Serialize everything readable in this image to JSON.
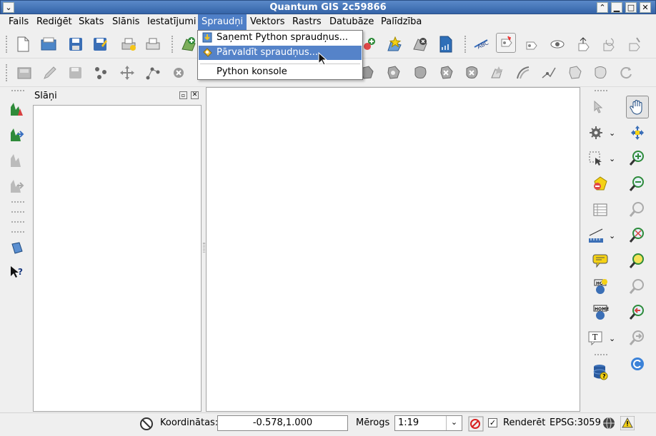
{
  "window": {
    "title": "Quantum GIS 2c59866"
  },
  "menubar": {
    "items": [
      "Fails",
      "Rediģēt",
      "Skats",
      "Slānis",
      "Iestatījumi",
      "Spraudņi",
      "Vektors",
      "Rastrs",
      "Datubāze",
      "Palīdzība"
    ],
    "active": "Spraudņi"
  },
  "plugins_menu": {
    "items": [
      {
        "label": "Saņemt Python spraudņus...",
        "icon": "python-plugin-download-icon"
      },
      {
        "label": "Pārvaldīt spraudņus...",
        "icon": "plugin-manage-icon",
        "selected": true
      },
      {
        "label": "Python konsole",
        "icon": ""
      }
    ]
  },
  "layers_panel": {
    "title": "Slāņi"
  },
  "statusbar": {
    "coordinates_label": "Koordinātas:",
    "coordinates_value": "-0.578,1.000",
    "scale_label": "Mērogs",
    "scale_value": "1:19",
    "render_label": "Renderēt",
    "render_checked": true,
    "crs": "EPSG:3059"
  },
  "colors": {
    "accent": "#4f7fc7",
    "titlebar": "#3f70b4"
  }
}
